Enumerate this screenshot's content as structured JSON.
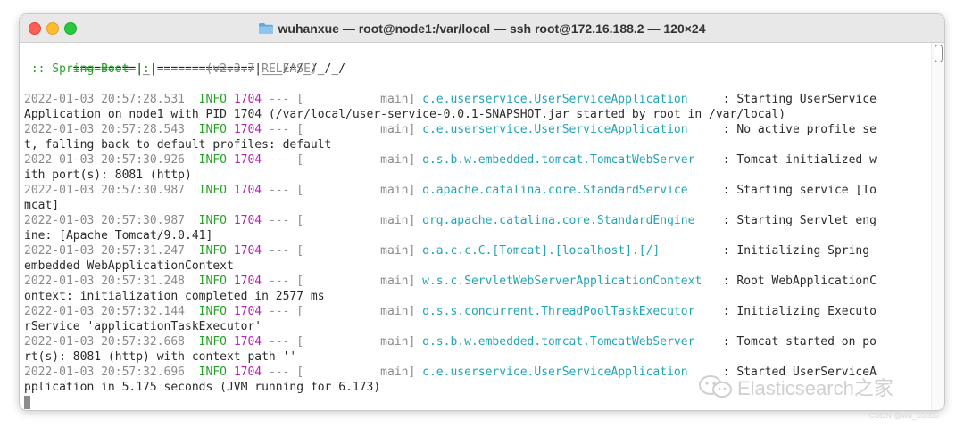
{
  "window": {
    "title": "wuhanxue — root@node1:/var/local — ssh root@172.16.188.2 — 120×24"
  },
  "banner": {
    "line1": " =========|_|==============|___/=/_/_/_/",
    "spring_label": " :: Spring Boot :: ",
    "spring_pad": "       ",
    "version": "(v2.3.7.RELEASE)"
  },
  "log": [
    {
      "ts": "2022-01-03 20:57:28.531",
      "level": "INFO",
      "pid": "1704",
      "sep": " --- [",
      "thread": "           main] ",
      "logger": "c.e.userservice.UserServiceApplication    ",
      "msg": " : Starting UserService",
      "cont": "Application on node1 with PID 1704 (/var/local/user-service-0.0.1-SNAPSHOT.jar started by root in /var/local)"
    },
    {
      "ts": "2022-01-03 20:57:28.543",
      "level": "INFO",
      "pid": "1704",
      "sep": " --- [",
      "thread": "           main] ",
      "logger": "c.e.userservice.UserServiceApplication    ",
      "msg": " : No active profile se",
      "cont": "t, falling back to default profiles: default"
    },
    {
      "ts": "2022-01-03 20:57:30.926",
      "level": "INFO",
      "pid": "1704",
      "sep": " --- [",
      "thread": "           main] ",
      "logger": "o.s.b.w.embedded.tomcat.TomcatWebServer   ",
      "msg": " : Tomcat initialized w",
      "cont": "ith port(s): 8081 (http)"
    },
    {
      "ts": "2022-01-03 20:57:30.987",
      "level": "INFO",
      "pid": "1704",
      "sep": " --- [",
      "thread": "           main] ",
      "logger": "o.apache.catalina.core.StandardService    ",
      "msg": " : Starting service [To",
      "cont": "mcat]"
    },
    {
      "ts": "2022-01-03 20:57:30.987",
      "level": "INFO",
      "pid": "1704",
      "sep": " --- [",
      "thread": "           main] ",
      "logger": "org.apache.catalina.core.StandardEngine   ",
      "msg": " : Starting Servlet eng",
      "cont": "ine: [Apache Tomcat/9.0.41]"
    },
    {
      "ts": "2022-01-03 20:57:31.247",
      "level": "INFO",
      "pid": "1704",
      "sep": " --- [",
      "thread": "           main] ",
      "logger": "o.a.c.c.C.[Tomcat].[localhost].[/]        ",
      "msg": " : Initializing Spring ",
      "cont": "embedded WebApplicationContext"
    },
    {
      "ts": "2022-01-03 20:57:31.248",
      "level": "INFO",
      "pid": "1704",
      "sep": " --- [",
      "thread": "           main] ",
      "logger": "w.s.c.ServletWebServerApplicationContext  ",
      "msg": " : Root WebApplicationC",
      "cont": "ontext: initialization completed in 2577 ms"
    },
    {
      "ts": "2022-01-03 20:57:32.144",
      "level": "INFO",
      "pid": "1704",
      "sep": " --- [",
      "thread": "           main] ",
      "logger": "o.s.s.concurrent.ThreadPoolTaskExecutor   ",
      "msg": " : Initializing Executo",
      "cont": "rService 'applicationTaskExecutor'"
    },
    {
      "ts": "2022-01-03 20:57:32.668",
      "level": "INFO",
      "pid": "1704",
      "sep": " --- [",
      "thread": "           main] ",
      "logger": "o.s.b.w.embedded.tomcat.TomcatWebServer   ",
      "msg": " : Tomcat started on po",
      "cont": "rt(s): 8081 (http) with context path ''"
    },
    {
      "ts": "2022-01-03 20:57:32.696",
      "level": "INFO",
      "pid": "1704",
      "sep": " --- [",
      "thread": "           main] ",
      "logger": "c.e.userservice.UserServiceApplication    ",
      "msg": " : Started UserServiceA",
      "cont": "pplication in 5.175 seconds (JVM running for 6.173)"
    }
  ],
  "watermark": {
    "text": "Elasticsearch之家",
    "csdn": "CSDN @wu_55555"
  },
  "colors": {
    "info": "#26a326",
    "pid": "#b622b6",
    "logger": "#1fa5b8",
    "timestamp": "#8a8a8a"
  }
}
